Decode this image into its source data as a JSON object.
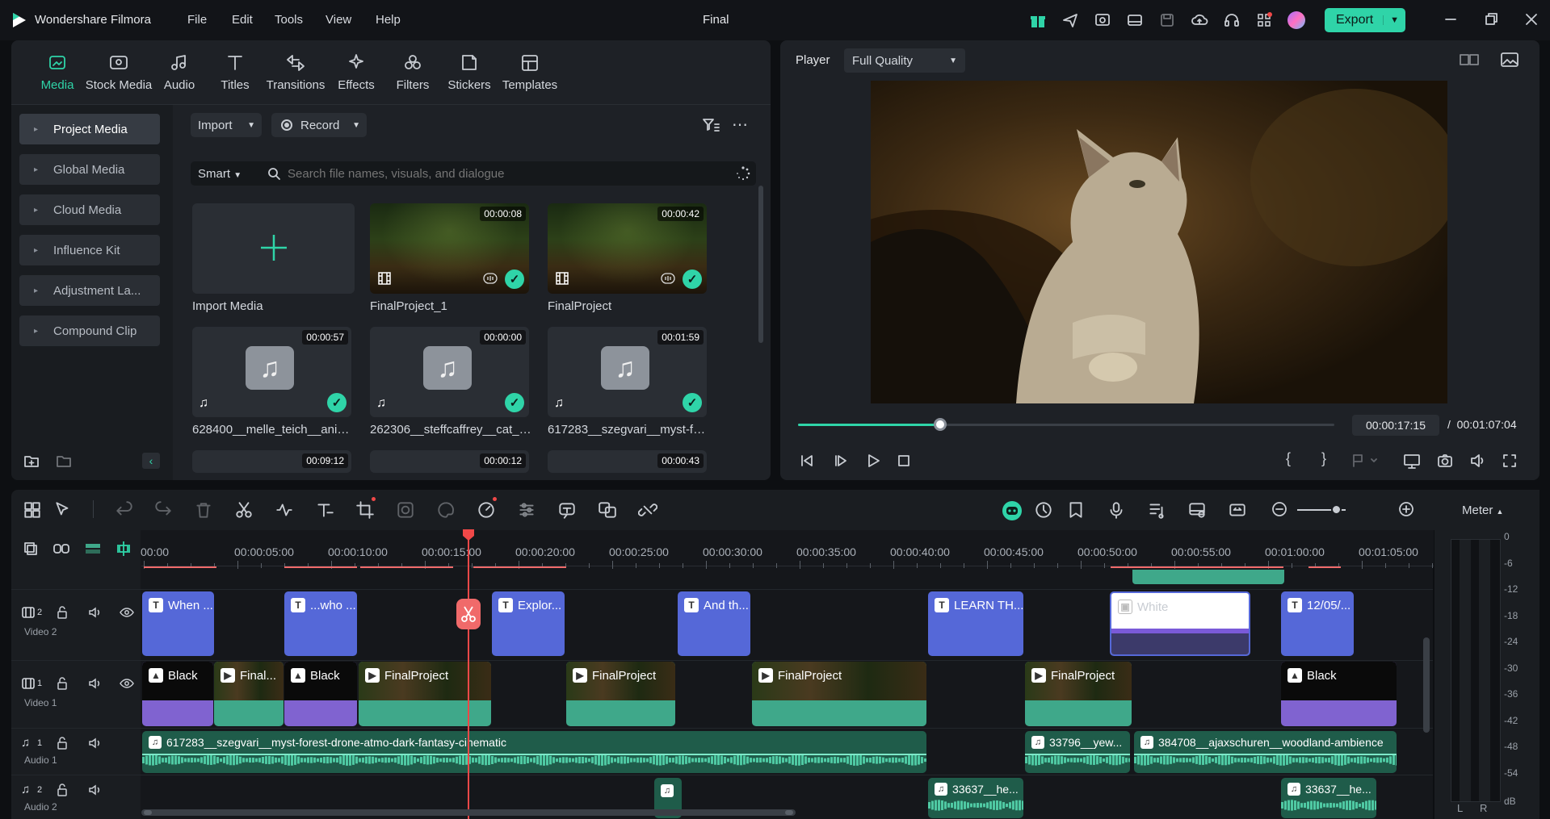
{
  "app": {
    "name": "Wondershare Filmora",
    "project_title": "Final",
    "menu": [
      "File",
      "Edit",
      "Tools",
      "View",
      "Help"
    ],
    "export_label": "Export"
  },
  "colors": {
    "accent": "#2fd4a8",
    "title_clip": "#5568d8",
    "video_clip": "#3fa88a",
    "audio_clip": "#2e8c6f",
    "playhead": "#f04848"
  },
  "media_tabs": [
    {
      "label": "Media",
      "icon": "media-icon",
      "active": true
    },
    {
      "label": "Stock Media",
      "icon": "stock-media-icon"
    },
    {
      "label": "Audio",
      "icon": "music-note-icon"
    },
    {
      "label": "Titles",
      "icon": "text-t-icon"
    },
    {
      "label": "Transitions",
      "icon": "transition-icon"
    },
    {
      "label": "Effects",
      "icon": "sparkle-icon"
    },
    {
      "label": "Filters",
      "icon": "filter-circles-icon"
    },
    {
      "label": "Stickers",
      "icon": "sticker-icon"
    },
    {
      "label": "Templates",
      "icon": "template-grid-icon"
    }
  ],
  "sidebar": [
    {
      "label": "Project Media",
      "active": true
    },
    {
      "label": "Global Media"
    },
    {
      "label": "Cloud Media"
    },
    {
      "label": "Influence Kit"
    },
    {
      "label": "Adjustment La..."
    },
    {
      "label": "Compound Clip"
    }
  ],
  "media_toolbar": {
    "import": "Import",
    "record": "Record",
    "smart": "Smart",
    "search_placeholder": "Search file names, visuals, and dialogue"
  },
  "media_items": [
    {
      "label": "Import Media",
      "type": "import"
    },
    {
      "label": "FinalProject_1",
      "duration": "00:00:08",
      "type": "video"
    },
    {
      "label": "FinalProject",
      "duration": "00:00:42",
      "type": "video"
    },
    {
      "label": "628400__melle_teich__anima...",
      "duration": "00:00:57",
      "type": "audio"
    },
    {
      "label": "262306__steffcaffrey__cat_tw...",
      "duration": "00:00:00",
      "type": "audio"
    },
    {
      "label": "617283__szegvari__myst-for...",
      "duration": "00:01:59",
      "type": "audio"
    },
    {
      "label": "",
      "duration": "00:09:12",
      "type": "partial"
    },
    {
      "label": "",
      "duration": "00:00:12",
      "type": "partial"
    },
    {
      "label": "",
      "duration": "00:00:43",
      "type": "partial"
    }
  ],
  "player": {
    "label": "Player",
    "quality": "Full Quality",
    "current_time": "00:00:17:15",
    "total_time": "/  00:01:07:04",
    "progress": 0.265
  },
  "timeline": {
    "ticks": [
      "00:00",
      "00:00:05:00",
      "00:00:10:00",
      "00:00:15:00",
      "00:00:20:00",
      "00:00:25:00",
      "00:00:30:00",
      "00:00:35:00",
      "00:00:40:00",
      "00:00:45:00",
      "00:00:50:00",
      "00:00:55:00",
      "00:01:00:00",
      "00:01:05:00"
    ],
    "meter_label": "Meter",
    "meter_scale": [
      "0",
      "-6",
      "-12",
      "-18",
      "-24",
      "-30",
      "-36",
      "-42",
      "-48",
      "-54",
      "dB"
    ],
    "meter_lr": [
      "L",
      "R"
    ],
    "tracks": [
      {
        "label": "Video 2",
        "num": "2"
      },
      {
        "label": "Video 1",
        "num": "1"
      },
      {
        "label": "Audio 1",
        "num": "1"
      },
      {
        "label": "Audio 2",
        "num": "2"
      }
    ],
    "title_clips": [
      "When ...",
      "...who ...",
      "Explor...",
      "And th...",
      "LEARN TH...",
      "White",
      "12/05/..."
    ],
    "video_clips": [
      "Black",
      "Final...",
      "Black",
      "FinalProject",
      "FinalProject",
      "FinalProject",
      "FinalProject",
      "Black"
    ],
    "audio1_clips": [
      "617283__szegvari__myst-forest-drone-atmo-dark-fantasy-cinematic",
      "33796__yew...",
      "384708__ajaxschuren__woodland-ambience"
    ],
    "audio2_clips": [
      "33637__he...",
      "33637__he..."
    ]
  }
}
